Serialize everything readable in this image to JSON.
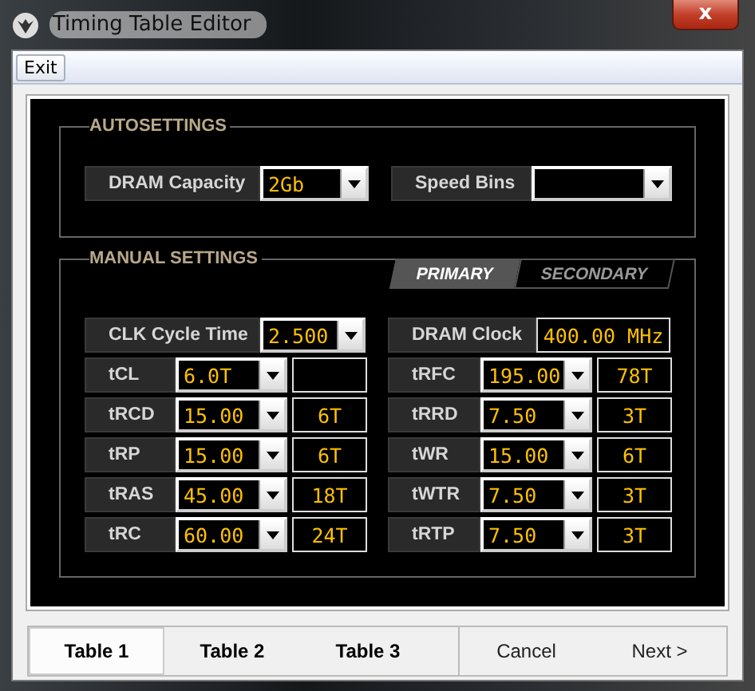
{
  "window": {
    "title": "Timing Table Editor",
    "close": "x"
  },
  "menu": [
    {
      "label": "Exit"
    }
  ],
  "autosettings": {
    "title": "AUTOSETTINGS",
    "fields": [
      {
        "label": "DRAM Capacity",
        "value": "2Gb"
      },
      {
        "label": "Speed Bins"
      }
    ]
  },
  "manual": {
    "title": "MANUAL SETTINGS",
    "tabs": [
      {
        "label": "PRIMARY",
        "selected": true
      },
      {
        "label": "SECONDARY",
        "selected": false
      }
    ],
    "clk": {
      "label": "CLK Cycle Time",
      "value": "2.500"
    },
    "dram_clock": {
      "label": "DRAM Clock",
      "value": "400.00 MHz"
    },
    "left": [
      {
        "label": "tCL",
        "value": "6.0T"
      },
      {
        "label": "tRCD",
        "value": "15.00",
        "result": "6T"
      },
      {
        "label": "tRP",
        "value": "15.00",
        "result": "6T"
      },
      {
        "label": "tRAS",
        "value": "45.00",
        "result": "18T"
      },
      {
        "label": "tRC",
        "value": "60.00",
        "result": "24T"
      }
    ],
    "right": [
      {
        "label": "tRFC",
        "value": "195.00",
        "result": "78T"
      },
      {
        "label": "tRRD",
        "value": "7.50",
        "result": "3T"
      },
      {
        "label": "tWR",
        "value": "15.00",
        "result": "6T"
      },
      {
        "label": "tWTR",
        "value": "7.50",
        "result": "3T"
      },
      {
        "label": "tRTP",
        "value": "7.50",
        "result": "3T"
      }
    ]
  },
  "bottom_tabs": [
    {
      "label": "Table 1",
      "selected": true
    },
    {
      "label": "Table 2",
      "selected": false
    },
    {
      "label": "Table 3",
      "selected": false
    }
  ],
  "buttons": [
    "Cancel",
    "Next >"
  ]
}
